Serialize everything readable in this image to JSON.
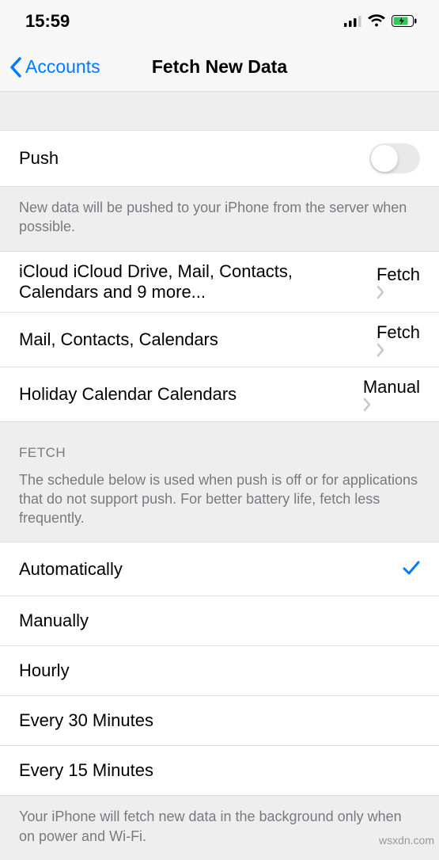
{
  "status": {
    "time": "15:59"
  },
  "nav": {
    "back": "Accounts",
    "title": "Fetch New Data"
  },
  "push": {
    "label": "Push",
    "footer": "New data will be pushed to your iPhone from the server when possible."
  },
  "accounts": [
    {
      "name": "iCloud",
      "detail": "iCloud Drive, Mail, Contacts, Calendars and 9 more...",
      "mode": "Fetch"
    },
    {
      "name": "",
      "detail": "Mail, Contacts, Calendars",
      "mode": "Fetch"
    },
    {
      "name": "Holiday Calendar",
      "detail": "Calendars",
      "mode": "Manual"
    }
  ],
  "fetch": {
    "header": "Fetch",
    "description": "The schedule below is used when push is off or for applications that do not support push. For better battery life, fetch less frequently.",
    "options": [
      "Automatically",
      "Manually",
      "Hourly",
      "Every 30 Minutes",
      "Every 15 Minutes"
    ],
    "selected": 0,
    "footer": "Your iPhone will fetch new data in the background only when on power and Wi-Fi."
  },
  "watermark": "wsxdn.com"
}
